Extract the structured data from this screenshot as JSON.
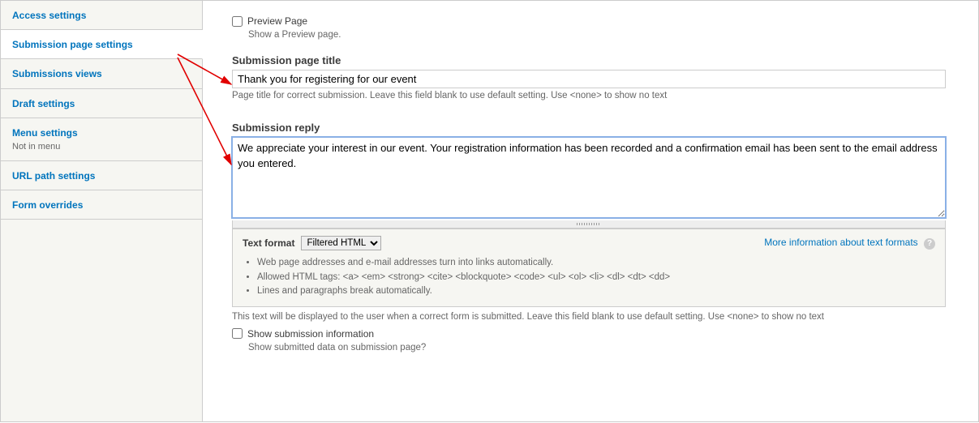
{
  "sidebar": {
    "items": [
      {
        "label": "Access settings"
      },
      {
        "label": "Submission page settings"
      },
      {
        "label": "Submissions views"
      },
      {
        "label": "Draft settings"
      },
      {
        "label": "Menu settings",
        "sub": "Not in menu"
      },
      {
        "label": "URL path settings"
      },
      {
        "label": "Form overrides"
      }
    ]
  },
  "preview": {
    "label": "Preview Page",
    "desc": "Show a Preview page."
  },
  "page_title": {
    "label": "Submission page title",
    "value": "Thank you for registering for our event",
    "hint": "Page title for correct submission. Leave this field blank to use default setting. Use <none> to show no text"
  },
  "reply": {
    "label": "Submission reply",
    "value": "We appreciate your interest in our event. Your registration information has been recorded and a confirmation email has been sent to the email address you entered."
  },
  "format": {
    "label": "Text format",
    "selected": "Filtered HTML",
    "more_link": "More information about text formats",
    "tips": [
      "Web page addresses and e-mail addresses turn into links automatically.",
      "Allowed HTML tags: <a> <em> <strong> <cite> <blockquote> <code> <ul> <ol> <li> <dl> <dt> <dd>",
      "Lines and paragraphs break automatically."
    ]
  },
  "post_hint": "This text will be displayed to the user when a correct form is submitted. Leave this field blank to use default setting. Use <none> to show no text",
  "show_info": {
    "label": "Show submission information",
    "desc": "Show submitted data on submission page?"
  }
}
